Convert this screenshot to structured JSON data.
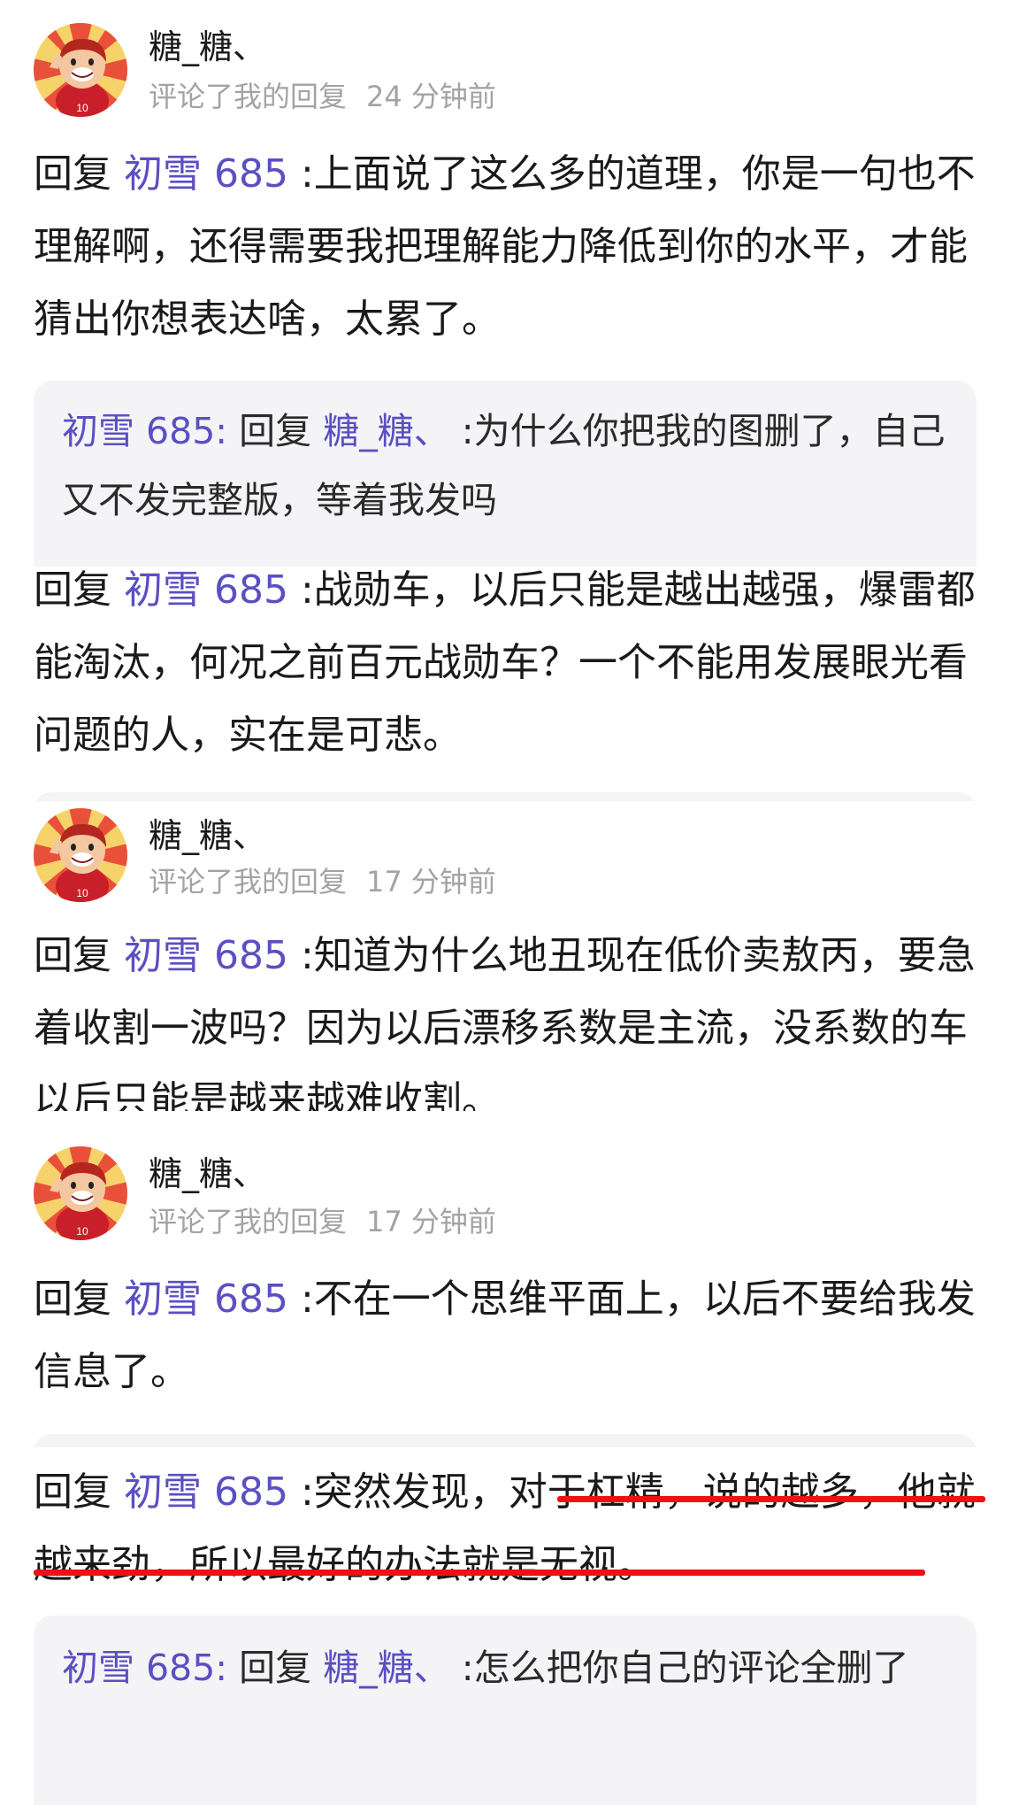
{
  "reply_prefix": "回复",
  "comments": [
    {
      "user": "糖_糖、",
      "action": "评论了我的回复",
      "time": "24 分钟前",
      "reply_to": "初雪 685",
      "text": ":上面说了这么多的道理，你是一句也不理解啊，还得需要我把理解能力降低到你的水平，才能猜出你想表达啥，太累了。",
      "quote": {
        "author": "初雪 685:",
        "prefix": "回复",
        "mention": "糖_糖、",
        "text": ":为什么你把我的图删了，自己又不发完整版，等着我发吗"
      }
    },
    {
      "reply_to": "初雪 685",
      "text": ":战勋车，以后只能是越出越强，爆雷都能淘汰，何况之前百元战勋车？一个不能用发展眼光看问题的人，实在是可悲。"
    },
    {
      "user": "糖_糖、",
      "action": "评论了我的回复",
      "time": "17 分钟前",
      "reply_to": "初雪 685",
      "text": ":知道为什么地丑现在低价卖敖丙，要急着收割一波吗？因为以后漂移系数是主流，没系数的车以后只能是越来越难收割。"
    },
    {
      "user": "糖_糖、",
      "action": "评论了我的回复",
      "time": "17 分钟前",
      "reply_to": "初雪 685",
      "text": ":不在一个思维平面上，以后不要给我发信息了。"
    },
    {
      "reply_to": "初雪 685",
      "text_before": ":突然发现，",
      "text_underlined_1": "对于杠精，说的越",
      "text_underlined_2": "多，他就越来劲，所以最好的办法就是无视。",
      "quote": {
        "author": "初雪 685:",
        "prefix": "回复",
        "mention": "糖_糖、",
        "text": ":怎么把你自己的评论全删了"
      }
    }
  ],
  "colors": {
    "mention": "#5b4fc2",
    "meta_gray": "#a3a3a3",
    "quote_bg": "#f4f4f6",
    "underline_red": "#ee1111"
  }
}
